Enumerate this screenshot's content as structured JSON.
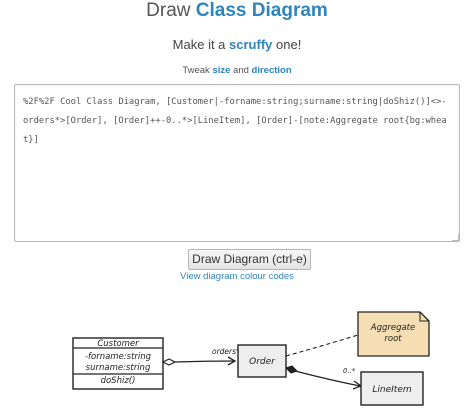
{
  "header": {
    "title_prefix": "Draw ",
    "title_highlight": "Class Diagram"
  },
  "subheader": {
    "prefix": "Make it a ",
    "link": "scruffy",
    "suffix": " one!"
  },
  "tweak": {
    "prefix": "Tweak ",
    "size_link": "size",
    "middle": " and ",
    "direction_link": "direction"
  },
  "editor": {
    "value": "%2F%2F Cool Class Diagram, [Customer|-forname:string;surname:string|doShiz()]<>-orders*>[Order], [Order]++-0..*>[LineItem], [Order]-[note:Aggregate root{bg:wheat}]"
  },
  "actions": {
    "draw_button": "Draw Diagram (ctrl-e)",
    "colour_codes_link": "View diagram colour codes"
  },
  "diagram": {
    "customer": {
      "name": "Customer",
      "attributes": [
        "-forname:string",
        "surname:string"
      ],
      "methods": [
        "doShiz()"
      ]
    },
    "order": {
      "name": "Order"
    },
    "lineitem": {
      "name": "LineItem"
    },
    "note": {
      "line1": "Aggregate",
      "line2": "root",
      "bg": "#f5deb3"
    },
    "orders_label": "orders*",
    "lineitem_label": "0..*"
  },
  "colors": {
    "accent": "#2e86c1",
    "note_bg": "#f5deb3",
    "box_fill": "#eeeeee",
    "ink": "#222222"
  }
}
